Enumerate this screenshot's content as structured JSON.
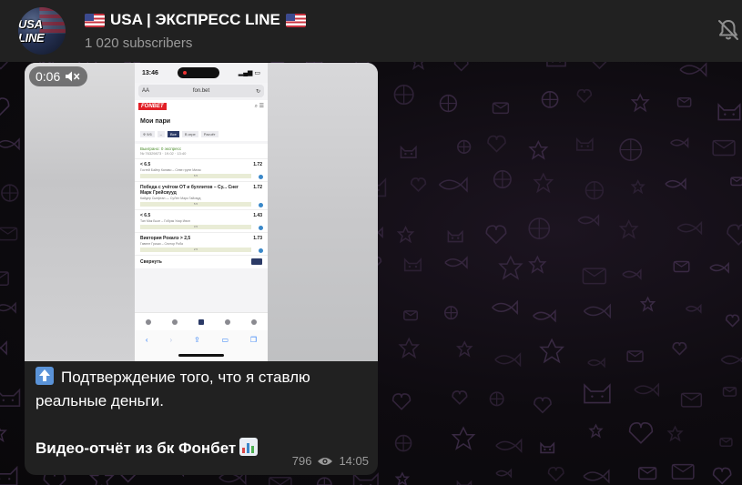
{
  "channel": {
    "avatar_text": "USA LINE",
    "title": "USA | ЭКСПРЕСС LINE",
    "subscribers": "1 020 subscribers"
  },
  "video": {
    "duration": "0:06",
    "phone": {
      "clock": "13:46",
      "url": "fon.bet",
      "url_left": "AA",
      "brand": "FONBET",
      "heading": "Мои пари",
      "tabs": [
        "Ф 9/6",
        "–",
        "Все",
        "В игре",
        "Расчёт"
      ],
      "coupon_head": "Выиграно: 0 экспресс",
      "coupon_sub": "№ 76329873 · 19.02 · 13:40",
      "rows": [
        {
          "title": "< 6.5",
          "odds": "1.72",
          "detail": "Гостей Байер Капаво – Севе групп Мигас",
          "bar": "6.5"
        },
        {
          "title": "Победа с учётом ОТ и буллитов – Су... Снег Марк Грейсвууд",
          "odds": "1.72",
          "detail": "Кайдер Сьефтан — СуЛен Марк Гайсвуд",
          "bar": "5.5"
        },
        {
          "title": "< 6.5",
          "odds": "1.43",
          "detail": "Тан Мак Бьон – Гобрак Укар Ивон",
          "bar": "3.5"
        },
        {
          "title": "Виктория Рокалэ > 2,5",
          "odds": "1.73",
          "detail": "Гавеле Гриши – Сектор Роба",
          "bar": "2.5"
        }
      ],
      "fold": "Свернуть",
      "nav": [
        "Спорт",
        "Лайв",
        "Купоны",
        "Бонусы",
        "Профиль"
      ]
    }
  },
  "message": {
    "line1": "Подтверждение того, что я ставлю реальные деньги.",
    "line2": "Видео-отчёт из бк Фонбет",
    "views": "796",
    "time": "14:05"
  },
  "colors": {
    "header_bg": "#212121",
    "bubble_bg": "#212121",
    "subtitle": "#9a9a9a",
    "pattern": "#3a2a44"
  },
  "icons": [
    "flag-us-icon",
    "mute-icon",
    "volume-icon",
    "arrow-up-emoji-icon",
    "chart-emoji-icon",
    "eye-icon"
  ]
}
